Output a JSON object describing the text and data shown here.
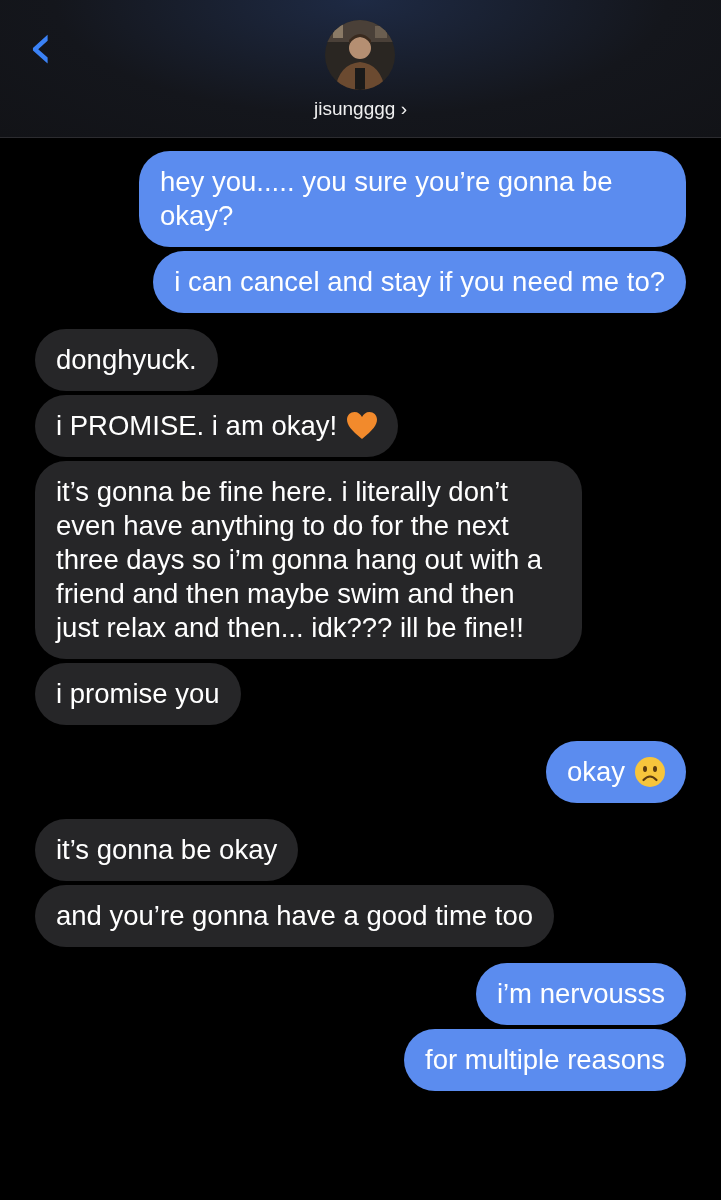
{
  "header": {
    "back": "‹",
    "contact_name": "jisungggg",
    "chevron": "›"
  },
  "messages": [
    {
      "kind": "sent",
      "text": "hey you..... you sure you’re gonna be okay?"
    },
    {
      "kind": "sent",
      "text": "i can cancel and stay if you need me to?"
    },
    {
      "kind": "received",
      "text": "donghyuck."
    },
    {
      "kind": "received",
      "text": "i PROMISE. i am okay!",
      "emoji": {
        "kind": "orange-heart"
      }
    },
    {
      "kind": "received",
      "text": "it’s gonna be fine here. i literally don’t even have anything to do for the next three days so i’m gonna hang out with a friend and then maybe swim and then just relax and then... idk??? ill be fine!!"
    },
    {
      "kind": "received",
      "text": "i promise you"
    },
    {
      "kind": "sent",
      "text": "okay",
      "emoji": {
        "kind": "frown"
      }
    },
    {
      "kind": "received",
      "text": "it’s gonna be okay"
    },
    {
      "kind": "received",
      "text": "and you’re gonna have a good time too"
    },
    {
      "kind": "sent",
      "text": "i’m nervousss"
    },
    {
      "kind": "sent",
      "text": "for multiple reasons"
    }
  ]
}
